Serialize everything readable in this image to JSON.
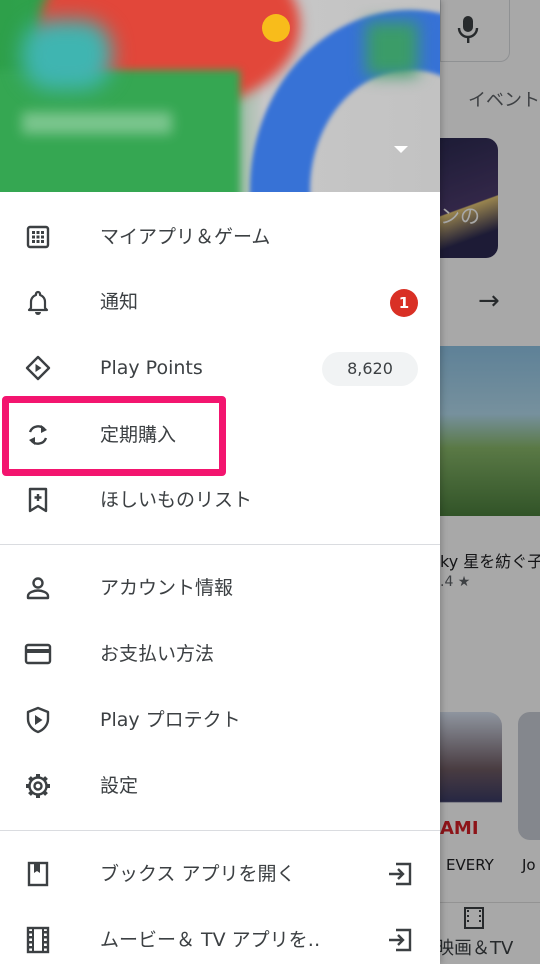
{
  "background": {
    "tab_label": "イベント",
    "card_overlay_text": "ンの",
    "banner_title": "ky 星を紡ぐ子",
    "banner_rating": ".4 ★",
    "game_badge": "AMI",
    "game_label_1": "EVERY",
    "game_label_2": "Jo",
    "bottom_nav_label": "映画＆TV",
    "next_arrow": "→"
  },
  "drawer": {
    "header": {
      "account_caret_icon": "caret-down-icon"
    },
    "items": [
      {
        "label": "マイアプリ＆ゲーム",
        "icon": "apps-grid-icon"
      },
      {
        "label": "通知",
        "icon": "bell-icon",
        "badge": "1"
      },
      {
        "label": "Play Points",
        "icon": "play-points-diamond-icon",
        "value": "8,620"
      },
      {
        "label": "定期購入",
        "icon": "refresh-sync-icon",
        "highlighted": true
      },
      {
        "label": "ほしいものリスト",
        "icon": "bookmark-plus-icon"
      },
      {
        "label": "アカウント情報",
        "icon": "person-icon"
      },
      {
        "label": "お支払い方法",
        "icon": "credit-card-icon"
      },
      {
        "label": "Play プロテクト",
        "icon": "shield-play-icon"
      },
      {
        "label": "設定",
        "icon": "gear-icon"
      },
      {
        "label": "ブックス アプリを開く",
        "icon": "book-icon",
        "trailing_icon": "open-app-icon"
      },
      {
        "label": "ムービー＆ TV アプリを‥",
        "icon": "film-icon",
        "trailing_icon": "open-app-icon"
      }
    ]
  },
  "colors": {
    "highlight": "#f3156f",
    "badge": "#d93025",
    "brand_green": "#34a853",
    "brand_red": "#ea4335",
    "brand_blue": "#4285f4",
    "brand_yellow": "#fbbc05"
  }
}
